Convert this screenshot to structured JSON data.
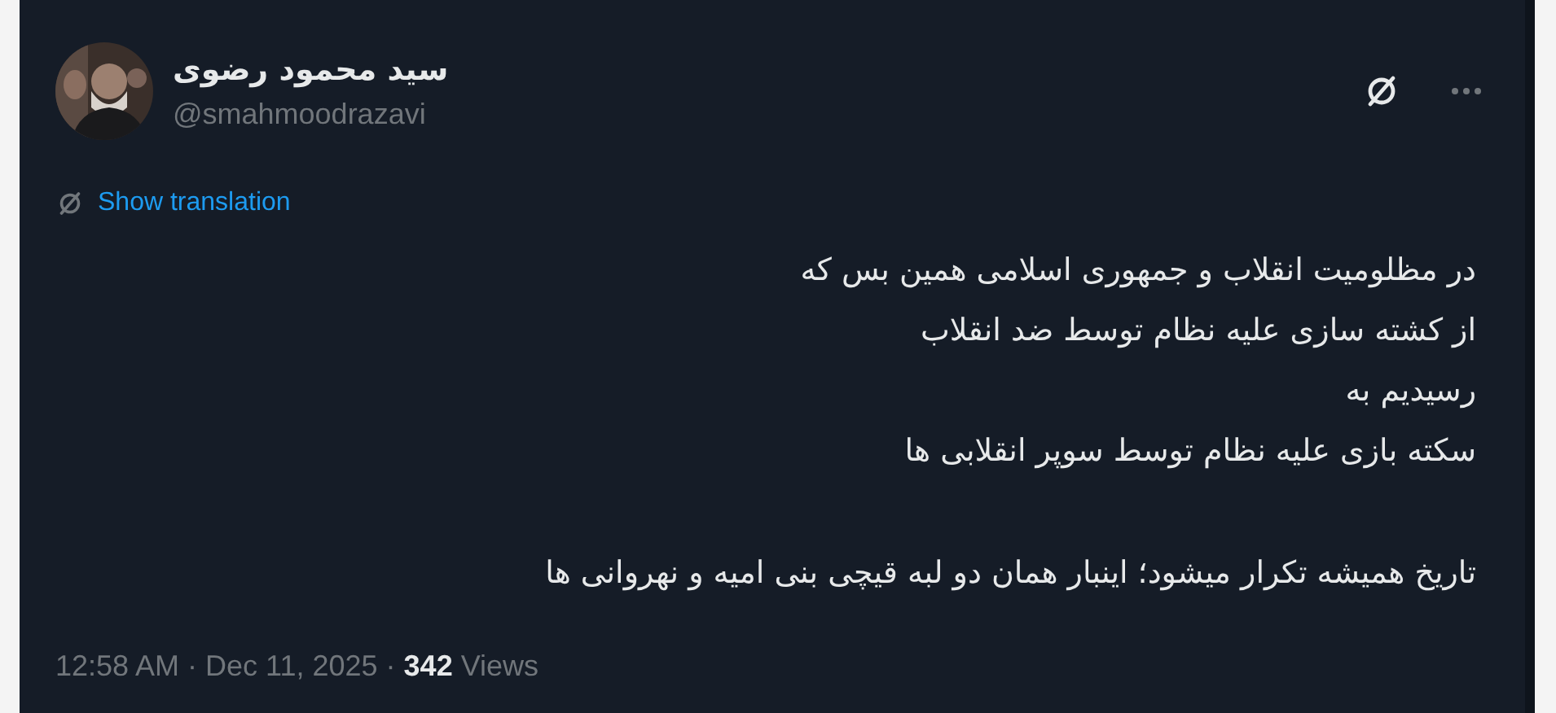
{
  "author": {
    "name": "سید محمود رضوی",
    "handle": "@smahmoodrazavi"
  },
  "translate_link": "Show translation",
  "body_paragraphs": [
    [
      "در مظلومیت انقلاب و جمهوری اسلامی همین بس که",
      "از کشته سازی علیه نظام توسط ضد انقلاب",
      "رسیدیم به",
      "سکته بازی علیه نظام توسط سوپر انقلابی ها"
    ],
    [
      "تاریخ همیشه تکرار میشود؛ اینبار همان دو لبه قیچی بنی امیه و نهروانی ها"
    ]
  ],
  "meta": "12:58 AM · Dec 11, 2025 · **342** Views"
}
